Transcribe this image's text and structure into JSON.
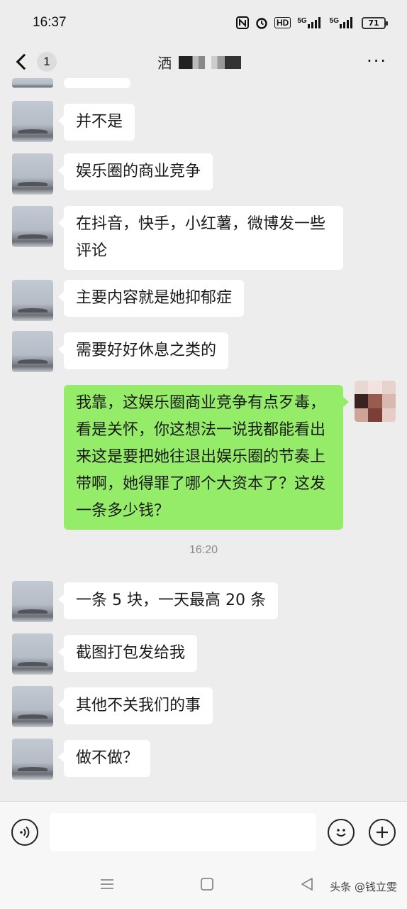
{
  "status_bar": {
    "time": "16:37",
    "icons": [
      "nfc-icon",
      "alarm-icon",
      "hd-icon",
      "5g-signal-icon",
      "5g-signal-icon"
    ],
    "hd_label": "HD",
    "net1_label": "5G",
    "net2_label": "5G",
    "battery": "71"
  },
  "nav": {
    "unread_count": "1",
    "title_char": "洒",
    "more_label": "···"
  },
  "messages": [
    {
      "from": "other",
      "text": "并不是"
    },
    {
      "from": "other",
      "text": "娱乐圈的商业竞争"
    },
    {
      "from": "other",
      "text": "在抖音，快手，小红薯，微博发一些评论"
    },
    {
      "from": "other",
      "text": "主要内容就是她抑郁症"
    },
    {
      "from": "other",
      "text": "需要好好休息之类的"
    },
    {
      "from": "me",
      "text": "我靠，这娱乐圈商业竞争有点歹毒，看是关怀，你这想法一说我都能看出来这是要把她往退出娱乐圈的节奏上带啊，她得罪了哪个大资本了？这发一条多少钱？"
    },
    {
      "from": "other",
      "text": "一条 5 块，一天最高 20 条"
    },
    {
      "from": "other",
      "text": "截图打包发给我"
    },
    {
      "from": "other",
      "text": "其他不关我们的事"
    },
    {
      "from": "other",
      "text": "做不做？"
    }
  ],
  "timestamp": "16:20",
  "watermark": "头条 @钱立雯",
  "colors": {
    "background": "#ededed",
    "sent_bubble": "#95ec69",
    "received_bubble": "#ffffff",
    "input_bar": "#f7f7f7"
  }
}
